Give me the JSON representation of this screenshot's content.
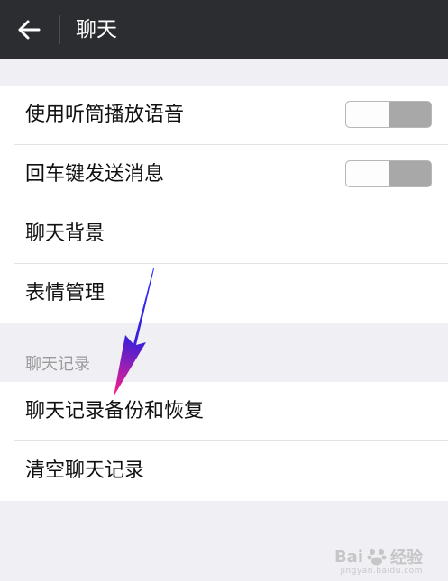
{
  "header": {
    "title": "聊天"
  },
  "groups": {
    "chat_settings": [
      {
        "label": "使用听筒播放语音",
        "toggle": "off"
      },
      {
        "label": "回车键发送消息",
        "toggle": "off"
      },
      {
        "label": "聊天背景"
      },
      {
        "label": "表情管理"
      }
    ],
    "history_section_title": "聊天记录",
    "history": [
      {
        "label": "聊天记录备份和恢复"
      },
      {
        "label": "清空聊天记录"
      }
    ]
  },
  "watermark": {
    "brand": "Bai",
    "brand2": "经验",
    "url": "jingyan.baidu.com"
  },
  "colors": {
    "header_bg": "#2b2d31",
    "page_bg": "#efeff4",
    "arrow_start": "#2a2cff",
    "arrow_end": "#ff1f8a"
  }
}
